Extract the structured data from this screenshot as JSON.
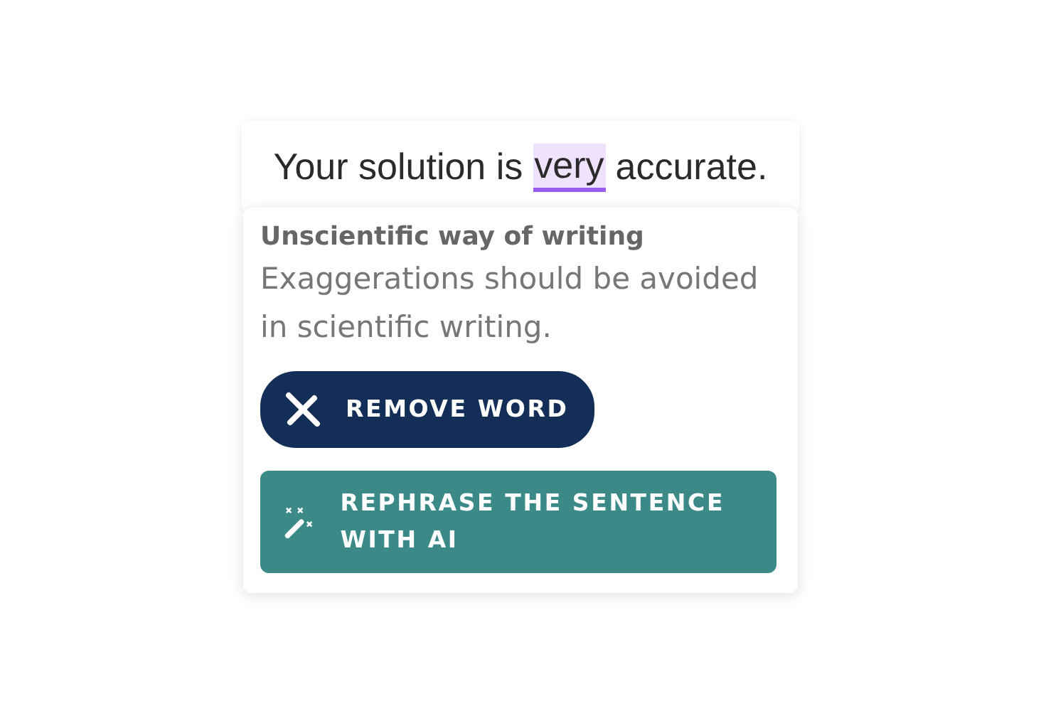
{
  "sentence": {
    "before": "Your solution is",
    "flagged": "very",
    "after": "accurate."
  },
  "suggestion": {
    "title": "Unscientific way of writing",
    "description": "Exaggerations should be avoided in scientific writing.",
    "actions": [
      {
        "kind": "remove",
        "label": "REMOVE WORD"
      },
      {
        "kind": "rephrase",
        "label": "REPHRASE THE SENTENCE WITH AI"
      }
    ]
  }
}
